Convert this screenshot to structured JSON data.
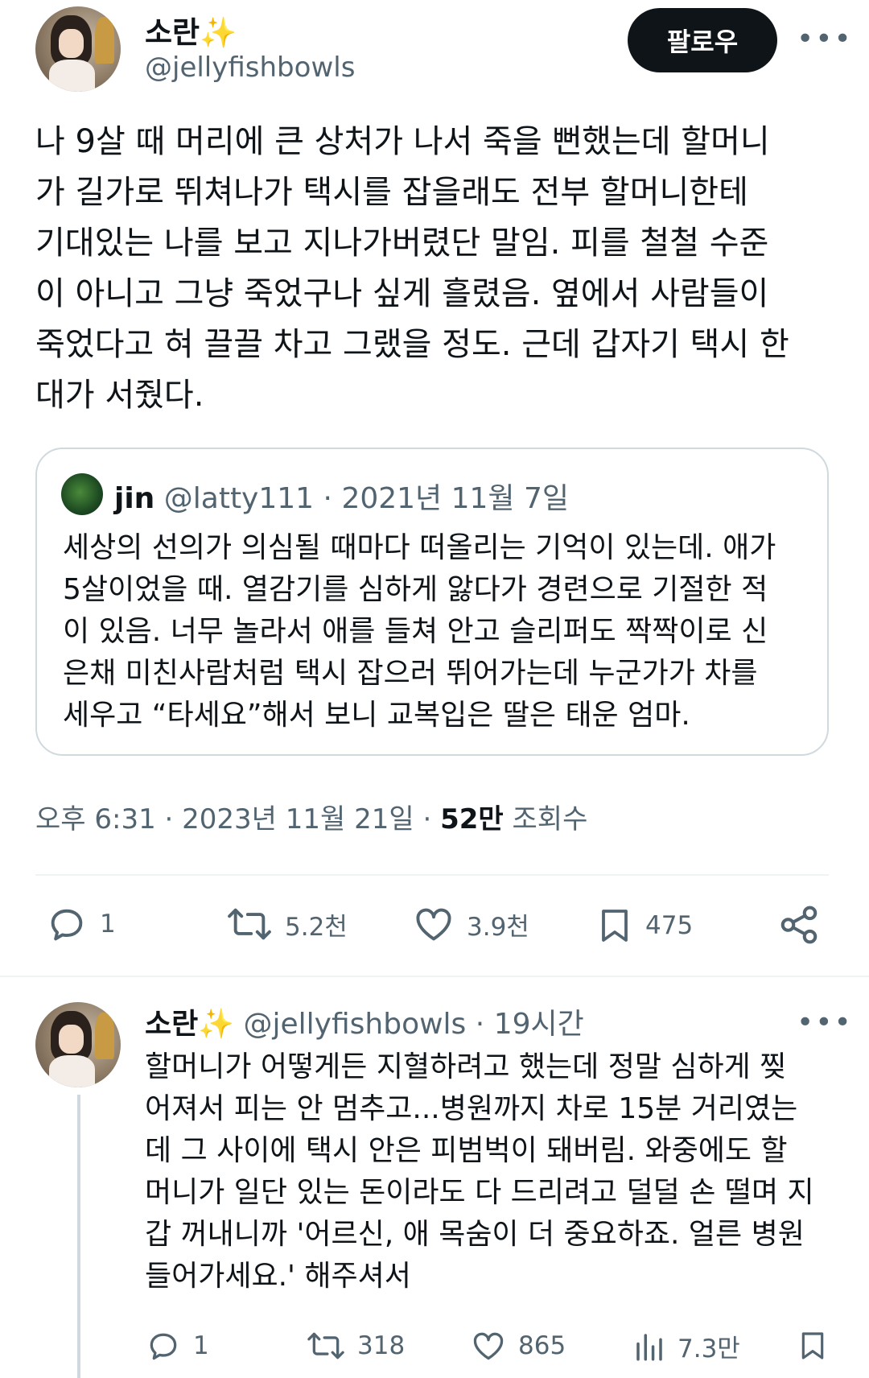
{
  "author": {
    "display_name": "소란",
    "sparkle": "✨",
    "handle": "@jellyfishbowls",
    "avatar_icon": "doll-avatar"
  },
  "header": {
    "follow_label": "팔로우",
    "more_label": "•••"
  },
  "tweet": {
    "lines": [
      "나 9살 때 머리에 큰 상처가 나서 죽을 뻔했는데 할머니",
      "가 길가로 뛰쳐나가 택시를 잡을래도 전부 할머니한테",
      "기대있는 나를 보고 지나가버렸단 말임. 피를 철철 수준",
      "이 아니고 그냥 죽었구나 싶게 흘렸음. 옆에서 사람들이",
      "죽었다고 혀 끌끌 차고 그랬을 정도. 근데 갑자기 택시 한",
      "대가 서줬다."
    ]
  },
  "quote": {
    "name": "jin",
    "handle": "@latty111",
    "separator": "·",
    "date": "2021년 11월 7일",
    "lines": [
      "세상의 선의가 의심될 때마다 떠올리는 기억이 있는데. 애가",
      "5살이었을 때. 열감기를 심하게 앓다가 경련으로 기절한 적",
      "이 있음. 너무 놀라서 애를 들쳐 안고 슬리퍼도 짝짝이로 신",
      "은채 미친사람처럼 택시 잡으러 뛰어가는데 누군가가 차를",
      "세우고 “타세요”해서 보니 교복입은 딸은 태운 엄마."
    ]
  },
  "meta": {
    "time": "오후 6:31",
    "separator": "·",
    "date": "2023년 11월 21일",
    "views_count": "52만",
    "views_label": "조회수"
  },
  "actions": {
    "replies": "1",
    "retweets": "5.2천",
    "likes": "3.9천",
    "bookmarks": "475"
  },
  "reply": {
    "display_name": "소란",
    "sparkle": "✨",
    "handle": "@jellyfishbowls",
    "separator": "·",
    "age": "19시간",
    "more_label": "•••",
    "lines": [
      "할머니가 어떻게든 지혈하려고 했는데 정말 심하게 찢",
      "어져서 피는 안 멈추고...병원까지 차로 15분 거리였는",
      "데 그 사이에 택시 안은 피범벅이 돼버림. 와중에도 할",
      "머니가 일단 있는 돈이라도 다 드리려고 덜덜 손 떨며 지",
      "갑 꺼내니까 '어르신, 애 목숨이 더 중요하죠. 얼른 병원",
      "들어가세요.' 해주셔서"
    ],
    "actions": {
      "replies": "1",
      "retweets": "318",
      "likes": "865",
      "views": "7.3만"
    }
  },
  "colors": {
    "text": "#0f1419",
    "muted": "#536471",
    "border": "#cfd9de",
    "sparkle": "#f5b82e",
    "follow_bg": "#0f1419"
  }
}
